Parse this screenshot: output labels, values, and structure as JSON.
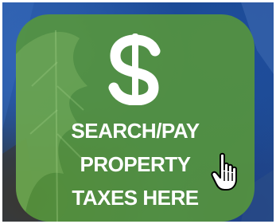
{
  "tile": {
    "icon": "dollar-sign-icon",
    "label_lines": [
      "SEARCH/PAY",
      "PROPERTY",
      "TAXES HERE"
    ]
  },
  "cursor": {
    "icon": "hand-pointer-icon"
  },
  "colors": {
    "tile_green": "#5a9a3c",
    "background_blue": "#1f4e9c",
    "text": "#ffffff"
  }
}
